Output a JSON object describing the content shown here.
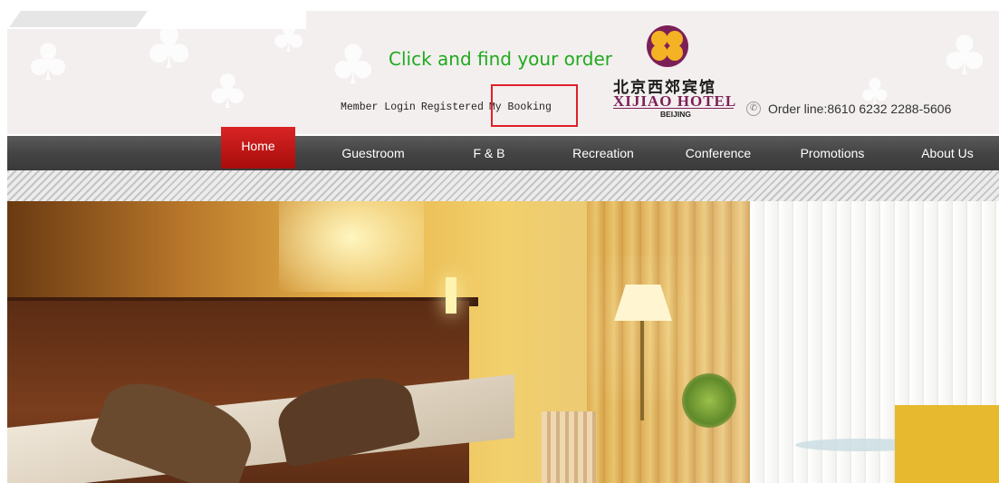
{
  "annotation": {
    "text": "Click and find your order"
  },
  "header": {
    "member_links": [
      "Member Login",
      "Registered",
      "My Booking"
    ],
    "logo": {
      "chinese_name": "北京西郊宾馆",
      "english_name": "XIJIAO HOTEL",
      "city": "BEIJING"
    },
    "order_line": "Order line:8610 6232 2288-5606"
  },
  "nav": {
    "items": [
      "Home",
      "Guestroom",
      "F & B",
      "Recreation",
      "Conference",
      "Promotions",
      "About Us"
    ],
    "active_index": 0
  },
  "colors": {
    "nav_active": "#c21818",
    "annotation_text": "#1faa1f",
    "highlight_box": "#e0202a",
    "logo_purple": "#7c1f57",
    "logo_gold": "#f3b324"
  },
  "icons": {
    "phone": "phone-icon",
    "logo": "clover-logo-icon"
  }
}
